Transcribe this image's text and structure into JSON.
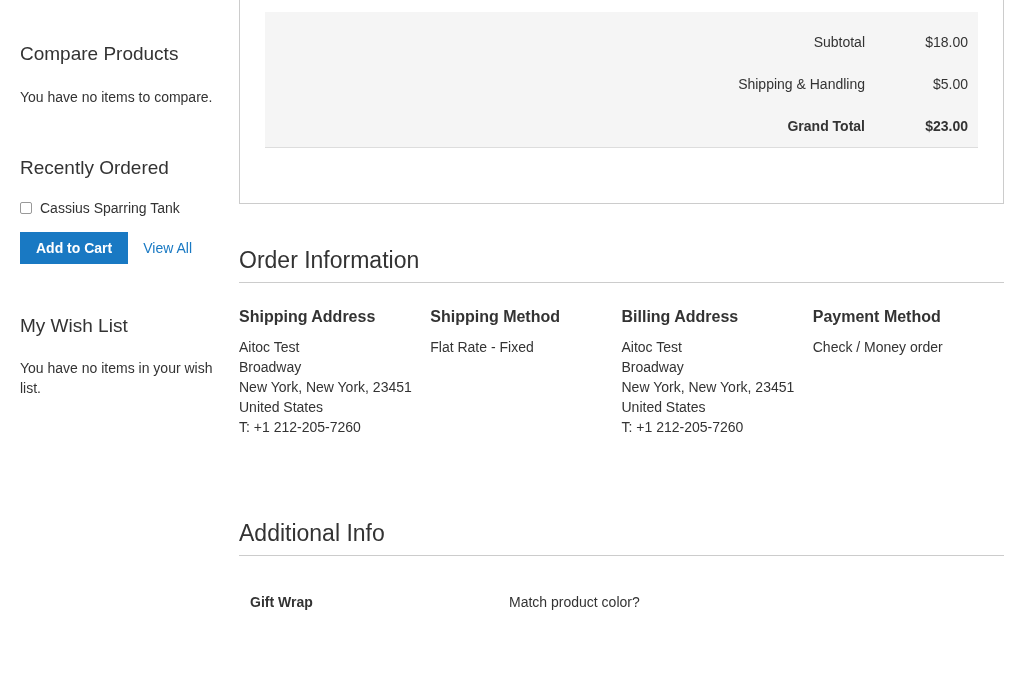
{
  "sidebar": {
    "compare": {
      "title": "Compare Products",
      "text": "You have no items to compare."
    },
    "recently_ordered": {
      "title": "Recently Ordered",
      "items": [
        {
          "label": "Cassius Sparring Tank",
          "checked": false
        }
      ],
      "add_button": "Add to Cart",
      "view_all": "View All"
    },
    "wishlist": {
      "title": "My Wish List",
      "text": "You have no items in your wish list."
    }
  },
  "totals": [
    {
      "label": "Subtotal",
      "value": "$18.00",
      "kind": "normal"
    },
    {
      "label": "Shipping & Handling",
      "value": "$5.00",
      "kind": "normal"
    },
    {
      "label": "Grand Total",
      "value": "$23.00",
      "kind": "grand"
    }
  ],
  "order_information": {
    "title": "Order Information",
    "columns": [
      {
        "title": "Shipping Address",
        "lines": [
          "Aitoc Test",
          "Broadway",
          "New York, New York, 23451",
          "United States",
          "T: +1 212-205-7260"
        ]
      },
      {
        "title": "Shipping Method",
        "lines": [
          "Flat Rate - Fixed"
        ]
      },
      {
        "title": "Billing Address",
        "lines": [
          "Aitoc Test",
          "Broadway",
          "New York, New York, 23451",
          "United States",
          "T: +1 212-205-7260"
        ]
      },
      {
        "title": "Payment Method",
        "lines": [
          "Check / Money order"
        ]
      }
    ]
  },
  "additional_info": {
    "title": "Additional Info",
    "rows": [
      {
        "label": "Gift Wrap",
        "value": "Match product color?"
      }
    ]
  }
}
